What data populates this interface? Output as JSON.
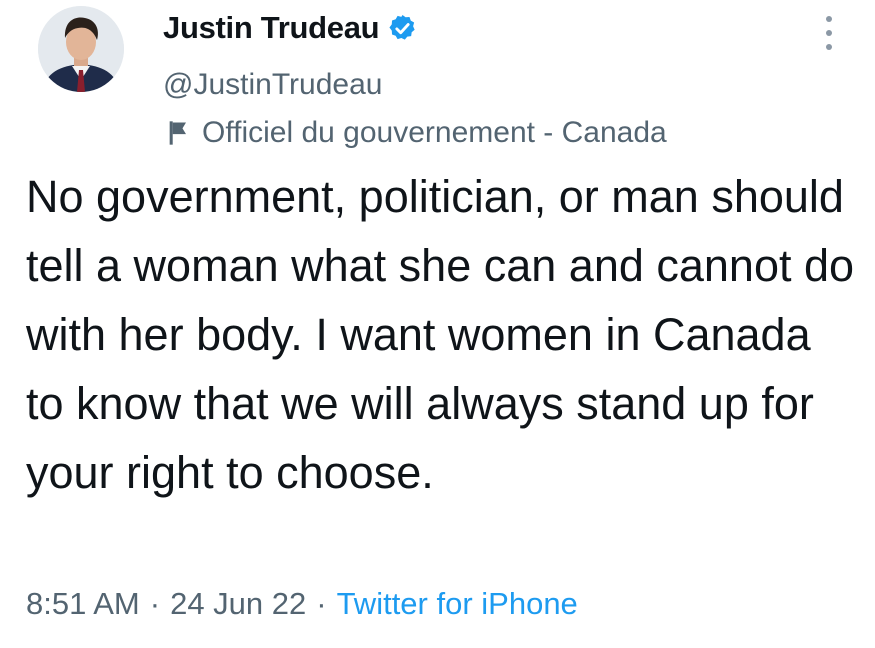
{
  "author": {
    "name": "Justin Trudeau",
    "handle": "@JustinTrudeau",
    "verified": true,
    "label": "Officiel du gouvernement - Canada"
  },
  "tweet": {
    "text": "No government, politician, or man should tell a woman what she can and cannot do with her body. I want women in Canada to know that we will always stand up for your right to choose.",
    "time": "8:51 AM",
    "date": "24 Jun 22",
    "source": "Twitter for iPhone",
    "separator": "·"
  },
  "icons": {
    "verified": "verified-badge-icon",
    "label": "flag-icon",
    "more": "more-options-icon"
  },
  "colors": {
    "text": "#0f1419",
    "secondary": "#536471",
    "link": "#1d9bf0",
    "verified": "#1d9bf0"
  }
}
